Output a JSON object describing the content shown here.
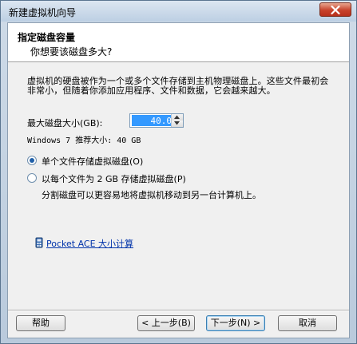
{
  "window": {
    "title": "新建虚拟机向导"
  },
  "header": {
    "title": "指定磁盘容量",
    "subtitle": "你想要该磁盘多大?"
  },
  "description": "虚拟机的硬盘被作为一个或多个文件存储到主机物理磁盘上。这些文件最初会非常小，但随着你添加应用程序、文件和数据，它会越来越大。",
  "disk_size": {
    "label": "最大磁盘大小(GB):",
    "value": "40.0"
  },
  "recommended": "Windows 7 推荐大小: 40 GB",
  "options": [
    {
      "label": "单个文件存储虚拟磁盘(O)",
      "checked": true
    },
    {
      "label": "以每个文件为 2 GB 存储虚拟磁盘(P)",
      "checked": false
    }
  ],
  "option_note": "分割磁盘可以更容易地将虚拟机移动到另一台计算机上。",
  "calculator_link": "Pocket ACE 大小计算",
  "buttons": {
    "help": "帮助",
    "back": "< 上一步(B)",
    "next": "下一步(N) >",
    "cancel": "取消"
  }
}
